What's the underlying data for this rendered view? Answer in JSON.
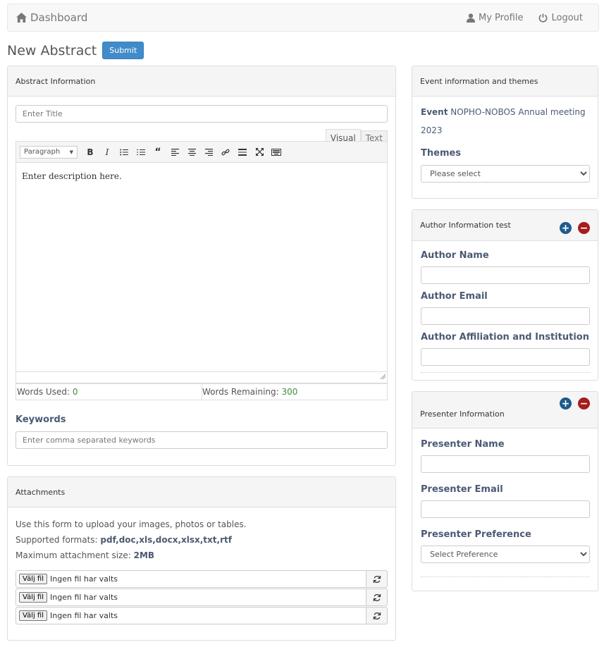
{
  "nav": {
    "brand": "Dashboard",
    "profile": "My Profile",
    "logout": "Logout"
  },
  "page": {
    "title": "New Abstract",
    "submit_label": "Submit"
  },
  "abstract_panel": {
    "heading": "Abstract Information",
    "title_placeholder": "Enter Title",
    "tab_visual": "Visual",
    "tab_text": "Text",
    "format_value": "Paragraph",
    "description": "Enter description here.",
    "words_used_label": "Words Used: ",
    "words_used": "0",
    "words_remaining_label": "Words Remaining: ",
    "words_remaining": "300",
    "keywords_label": "Keywords",
    "keywords_placeholder": "Enter comma separated keywords"
  },
  "attachments": {
    "heading": "Attachments",
    "line1": "Use this form to upload your images, photos or tables.",
    "formats_label": "Supported formats: ",
    "formats": "pdf,doc,xls,docx,xlsx,txt,rtf",
    "max_label": "Maximum attachment size: ",
    "max_size": "2MB",
    "choose_file": "Välj fil",
    "no_file": "Ingen fil har valts"
  },
  "event_panel": {
    "heading": "Event information and themes",
    "event_label": "Event",
    "event_name": " NOPHO-NOBOS Annual meeting 2023",
    "themes_label": "Themes",
    "themes_value": "Please select"
  },
  "author_panel": {
    "heading": "Author Information test",
    "name_label": "Author Name",
    "email_label": "Author Email",
    "affiliation_label": "Author Affiliation and Institution"
  },
  "presenter_panel": {
    "heading": "Presenter Information",
    "name_label": "Presenter Name",
    "email_label": "Presenter Email",
    "preference_label": "Presenter Preference",
    "preference_value": "Select Preference"
  },
  "colors": {
    "primary": "#428bca",
    "add": "#1d5a8e",
    "remove": "#a61d1d",
    "label": "#4b5a73"
  }
}
